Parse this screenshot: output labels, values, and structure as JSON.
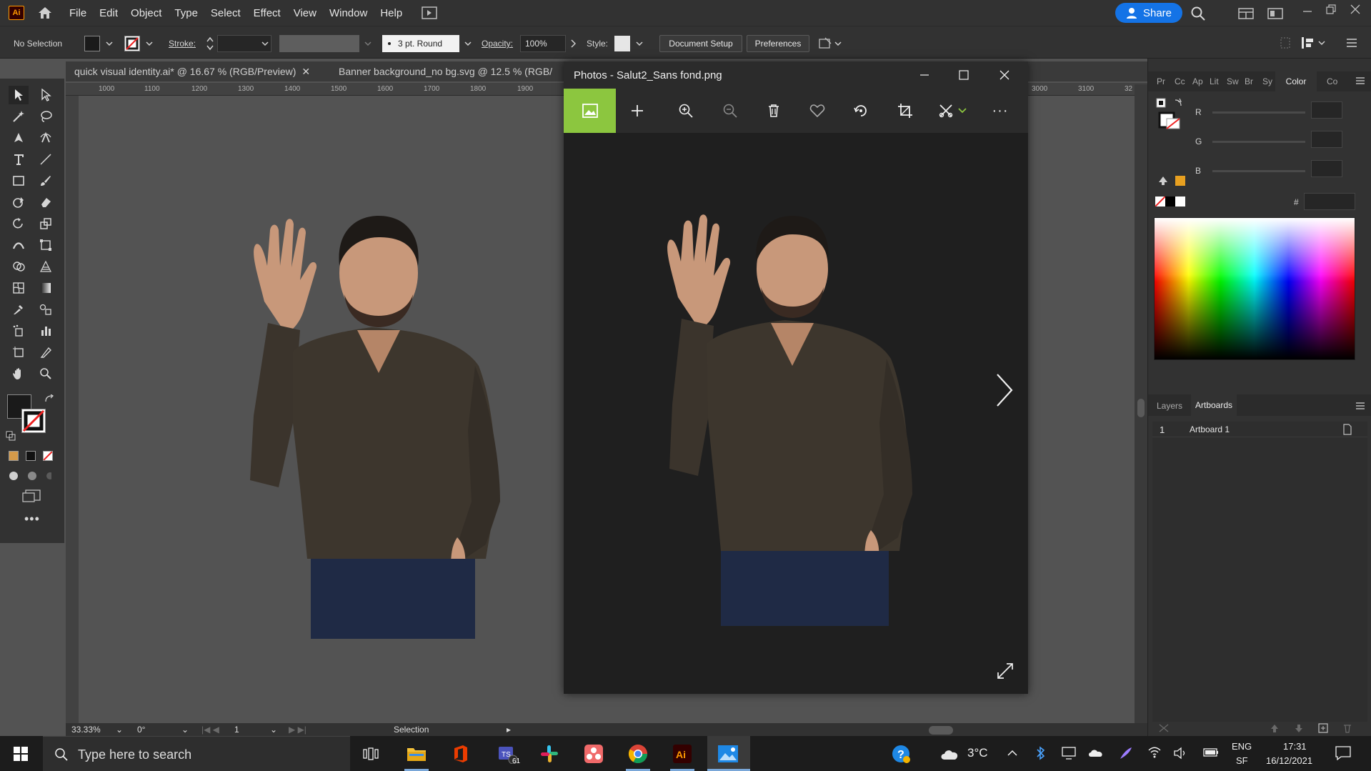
{
  "menubar": {
    "app_icon_label": "Ai",
    "items": [
      "File",
      "Edit",
      "Object",
      "Type",
      "Select",
      "Effect",
      "View",
      "Window",
      "Help"
    ],
    "share_label": "Share"
  },
  "controlbar": {
    "selection_label": "No Selection",
    "stroke_label": "Stroke:",
    "brush_value": "3 pt. Round",
    "opacity_label": "Opacity:",
    "opacity_value": "100%",
    "style_label": "Style:",
    "document_setup": "Document Setup",
    "preferences": "Preferences"
  },
  "tabs": [
    {
      "label": "quick visual identity.ai* @ 16.67 % (RGB/Preview)"
    },
    {
      "label": "Banner background_no bg.svg @ 12.5 % (RGB/"
    }
  ],
  "ruler": {
    "ticks": [
      "1000",
      "1100",
      "1200",
      "1300",
      "1400",
      "1500",
      "1600",
      "1700",
      "1800",
      "1900"
    ],
    "right_ticks": [
      "3000",
      "3100",
      "32"
    ]
  },
  "photos": {
    "title": "Photos - Salut2_Sans fond.png"
  },
  "rightpanel": {
    "top_tabs": [
      "Pr",
      "Cc",
      "Ap",
      "Lit",
      "Sw",
      "Br",
      "Sy"
    ],
    "color_tab": "Color",
    "co_tab": "Co",
    "r_label": "R",
    "g_label": "G",
    "b_label": "B",
    "hash_label": "#",
    "layers_tab": "Layers",
    "artboards_tab": "Artboards",
    "artboard_rows": [
      {
        "num": "1",
        "name": "Artboard 1"
      }
    ],
    "accent_color": "#e8a020"
  },
  "statusbar": {
    "zoom": "33.33%",
    "rotation": "0°",
    "artboard_index": "1",
    "tool": "Selection"
  },
  "taskbar": {
    "search_placeholder": "Type here to search",
    "badge_count": "61",
    "weather": "3°C",
    "lang1": "ENG",
    "lang2": "SF",
    "time": "17:31",
    "date": "16/12/2021"
  }
}
